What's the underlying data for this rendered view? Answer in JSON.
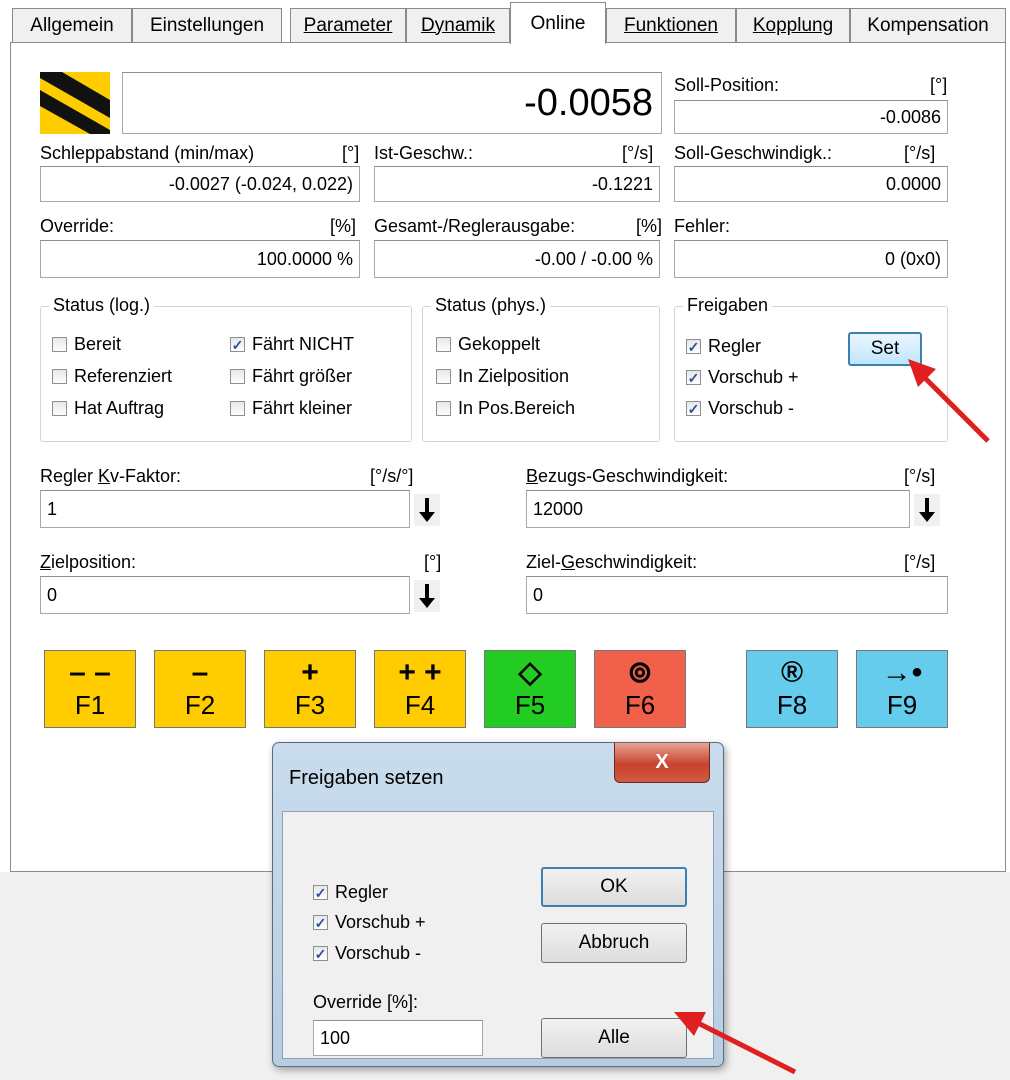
{
  "tabs": [
    {
      "label": "Allgemein",
      "active": false
    },
    {
      "label": "Einstellungen",
      "active": false
    },
    {
      "label": "Parameter",
      "active": false
    },
    {
      "label": "Dynamik",
      "active": false
    },
    {
      "label": "Online",
      "active": true
    },
    {
      "label": "Funktionen",
      "active": false
    },
    {
      "label": "Kopplung",
      "active": false
    },
    {
      "label": "Kompensation",
      "active": false
    }
  ],
  "position": {
    "actual_value": "-0.0058"
  },
  "soll_position": {
    "label": "Soll-Position:",
    "unit": "[°]",
    "value": "-0.0086"
  },
  "schleppabstand": {
    "label": "Schleppabstand (min/max)",
    "unit": "[°]",
    "value": "-0.0027  (-0.024, 0.022)"
  },
  "ist_geschw": {
    "label": "Ist-Geschw.:",
    "unit": "[°/s]",
    "value": "-0.1221"
  },
  "soll_geschw": {
    "label": "Soll-Geschwindigk.:",
    "unit": "[°/s]",
    "value": "0.0000"
  },
  "override": {
    "label": "Override:",
    "unit": "[%]",
    "value": "100.0000 %"
  },
  "gesamt": {
    "label": "Gesamt-/Reglerausgabe:",
    "unit": "[%]",
    "value": "-0.00 / -0.00 %"
  },
  "fehler": {
    "label": "Fehler:",
    "value": "0 (0x0)"
  },
  "status_log": {
    "title": "Status (log.)",
    "items": [
      {
        "label": "Bereit",
        "checked": false
      },
      {
        "label": "Referenziert",
        "checked": false
      },
      {
        "label": "Hat Auftrag",
        "checked": false
      },
      {
        "label": "Fährt NICHT",
        "checked": true
      },
      {
        "label": "Fährt größer",
        "checked": false
      },
      {
        "label": "Fährt kleiner",
        "checked": false
      }
    ]
  },
  "status_phys": {
    "title": "Status (phys.)",
    "items": [
      {
        "label": "Gekoppelt",
        "checked": false
      },
      {
        "label": "In Zielposition",
        "checked": false
      },
      {
        "label": "In Pos.Bereich",
        "checked": false
      }
    ]
  },
  "freigaben": {
    "title": "Freigaben",
    "set_label": "Set",
    "items": [
      {
        "label": "Regler",
        "checked": true
      },
      {
        "label": "Vorschub +",
        "checked": true
      },
      {
        "label": "Vorschub -",
        "checked": true
      }
    ]
  },
  "kv_faktor": {
    "label_pre": "Regler ",
    "label_u": "K",
    "label_post": "v-Faktor:",
    "unit": "[°/s/°]",
    "value": "1"
  },
  "bezugs_geschw": {
    "label_pre": "",
    "label_u": "B",
    "label_post": "ezugs-Geschwindigkeit:",
    "unit": "[°/s]",
    "value": "12000"
  },
  "zielposition": {
    "label_pre": "",
    "label_u": "Z",
    "label_post": "ielposition:",
    "unit": "[°]",
    "value": "0"
  },
  "ziel_geschw": {
    "label_pre": "Ziel-",
    "label_u": "G",
    "label_post": "eschwindigkeit:",
    "unit": "[°/s]",
    "value": "0"
  },
  "fkeys": [
    {
      "label": "F1",
      "symbol": "– –",
      "color": "#ffcc00"
    },
    {
      "label": "F2",
      "symbol": "–",
      "color": "#ffcc00"
    },
    {
      "label": "F3",
      "symbol": "+",
      "color": "#ffcc00"
    },
    {
      "label": "F4",
      "symbol": "+ +",
      "color": "#ffcc00"
    },
    {
      "label": "F5",
      "symbol": "◇",
      "color": "#22cc22"
    },
    {
      "label": "F6",
      "symbol": "⊚",
      "color": "#f0604a"
    },
    {
      "label": "F8",
      "symbol": "®",
      "color": "#66ccee"
    },
    {
      "label": "F9",
      "symbol": "→•",
      "color": "#66ccee"
    }
  ],
  "dialog": {
    "title": "Freigaben setzen",
    "close_symbol": "X",
    "items": [
      {
        "label": "Regler",
        "checked": true
      },
      {
        "label": "Vorschub +",
        "checked": true
      },
      {
        "label": "Vorschub -",
        "checked": true
      }
    ],
    "ok_label": "OK",
    "cancel_label": "Abbruch",
    "all_label": "Alle",
    "override_label": "Override [%]:",
    "override_value": "100"
  },
  "colors": {
    "annotation_arrow": "#e02020",
    "selected_button_border": "#3c7fb1"
  }
}
